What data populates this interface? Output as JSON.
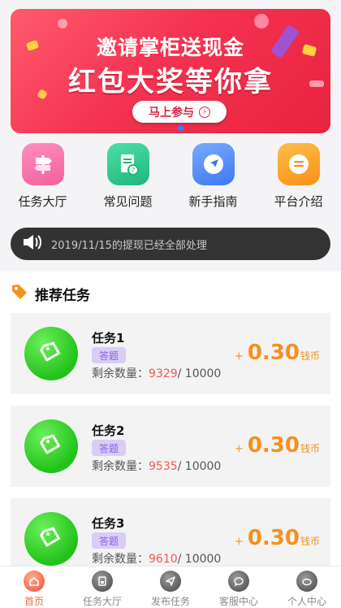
{
  "banner": {
    "line1": "邀请掌柜送现金",
    "line2": "红包大奖等你拿",
    "cta": "马上参与"
  },
  "quick": [
    {
      "label": "任务大厅",
      "icon": "signpost-icon",
      "color": "#f56fa5"
    },
    {
      "label": "常见问题",
      "icon": "document-question-icon",
      "color": "#26c48c"
    },
    {
      "label": "新手指南",
      "icon": "compass-arrow-icon",
      "color": "#4d89f5"
    },
    {
      "label": "平台介绍",
      "icon": "chat-bubble-icon",
      "color": "#fb9a22"
    }
  ],
  "notice": {
    "text": "2019/11/15的提现已经全部处理"
  },
  "section": {
    "title": "推荐任务"
  },
  "tasks": [
    {
      "name": "任务1",
      "tag": "答题",
      "remain_label": "剩余数量：",
      "remaining": "9329",
      "total": "/ 10000",
      "plus": "+",
      "amount": "0.30",
      "unit": "钱币"
    },
    {
      "name": "任务2",
      "tag": "答题",
      "remain_label": "剩余数量：",
      "remaining": "9535",
      "total": "/ 10000",
      "plus": "+",
      "amount": "0.30",
      "unit": "钱币"
    },
    {
      "name": "任务3",
      "tag": "答题",
      "remain_label": "剩余数量：",
      "remaining": "9610",
      "total": "/ 10000",
      "plus": "+",
      "amount": "0.30",
      "unit": "钱币"
    }
  ],
  "tabbar": [
    {
      "label": "首页",
      "icon": "home-icon",
      "active": true
    },
    {
      "label": "任务大厅",
      "icon": "task-hall-icon",
      "active": false
    },
    {
      "label": "发布任务",
      "icon": "send-icon",
      "active": false
    },
    {
      "label": "客服中心",
      "icon": "customer-service-icon",
      "active": false
    },
    {
      "label": "个人中心",
      "icon": "profile-icon",
      "active": false
    }
  ],
  "colors": {
    "accent": "#f6901e",
    "banner": "#f43350",
    "tag": "#8a63e0",
    "remaining": "#ef5a5a"
  }
}
